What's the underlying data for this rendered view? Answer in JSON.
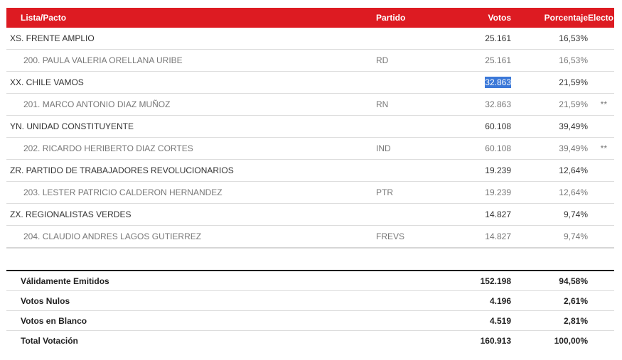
{
  "header": {
    "col_list": "Lista/Pacto",
    "col_party": "Partido",
    "col_votes": "Votos",
    "col_pct": "Porcentaje",
    "col_elected": "Electo"
  },
  "rows": [
    {
      "name": "XS. FRENTE AMPLIO",
      "party": "",
      "votes": "25.161",
      "pct": "16,53%",
      "elected": ""
    },
    {
      "name": "200. PAULA VALERIA ORELLANA URIBE",
      "party": "RD",
      "votes": "25.161",
      "pct": "16,53%",
      "elected": ""
    },
    {
      "name": "XX. CHILE VAMOS",
      "party": "",
      "votes": "32.863",
      "pct": "21,59%",
      "elected": ""
    },
    {
      "name": "201. MARCO ANTONIO DIAZ MUÑOZ",
      "party": "RN",
      "votes": "32.863",
      "pct": "21,59%",
      "elected": "**"
    },
    {
      "name": "YN. UNIDAD CONSTITUYENTE",
      "party": "",
      "votes": "60.108",
      "pct": "39,49%",
      "elected": ""
    },
    {
      "name": "202. RICARDO HERIBERTO DIAZ CORTES",
      "party": "IND",
      "votes": "60.108",
      "pct": "39,49%",
      "elected": "**"
    },
    {
      "name": "ZR. PARTIDO DE TRABAJADORES REVOLUCIONARIOS",
      "party": "",
      "votes": "19.239",
      "pct": "12,64%",
      "elected": ""
    },
    {
      "name": "203. LESTER PATRICIO CALDERON HERNANDEZ",
      "party": "PTR",
      "votes": "19.239",
      "pct": "12,64%",
      "elected": ""
    },
    {
      "name": "ZX. REGIONALISTAS VERDES",
      "party": "",
      "votes": "14.827",
      "pct": "9,74%",
      "elected": ""
    },
    {
      "name": "204. CLAUDIO ANDRES LAGOS GUTIERREZ",
      "party": "FREVS",
      "votes": "14.827",
      "pct": "9,74%",
      "elected": ""
    }
  ],
  "totals": [
    {
      "label": "Válidamente Emitidos",
      "votes": "152.198",
      "pct": "94,58%"
    },
    {
      "label": "Votos Nulos",
      "votes": "4.196",
      "pct": "2,61%"
    },
    {
      "label": "Votos en Blanco",
      "votes": "4.519",
      "pct": "2,81%"
    },
    {
      "label": "Total Votación",
      "votes": "160.913",
      "pct": "100,00%"
    }
  ],
  "colors": {
    "header_bg": "#dd1b22",
    "selection": "#3b78d8"
  }
}
